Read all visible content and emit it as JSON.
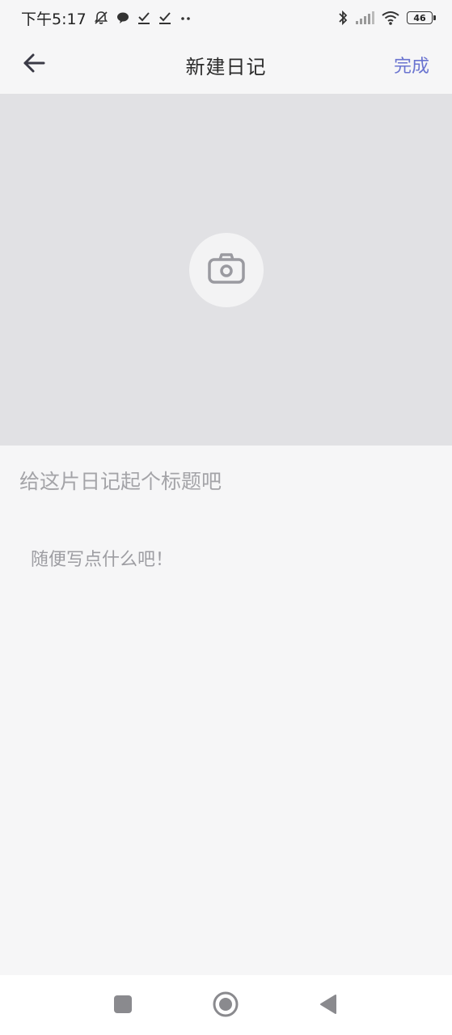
{
  "status_bar": {
    "time": "下午5:17",
    "icons_left": [
      "mute-bell-icon",
      "chat-bubble-icon",
      "download-check-icon",
      "download-check-icon",
      "more-dots-icon"
    ],
    "icons_right": [
      "bluetooth-icon",
      "signal-icon",
      "wifi-icon",
      "battery-icon"
    ],
    "battery_level": "46"
  },
  "app_bar": {
    "title": "新建日记",
    "done_label": "完成",
    "back_icon": "arrow-left-icon"
  },
  "photo": {
    "icon": "camera-icon"
  },
  "form": {
    "title_placeholder": "给这片日记起个标题吧",
    "title_value": "",
    "body_placeholder": "随便写点什么吧！",
    "body_value": ""
  },
  "nav_bar": {
    "icons": [
      "recents-square-icon",
      "home-circle-icon",
      "back-triangle-icon"
    ]
  },
  "colors": {
    "accent": "#6a74d0",
    "background": "#f6f6f7",
    "photo_area": "#e1e1e4",
    "placeholder": "#a4a4a8"
  }
}
